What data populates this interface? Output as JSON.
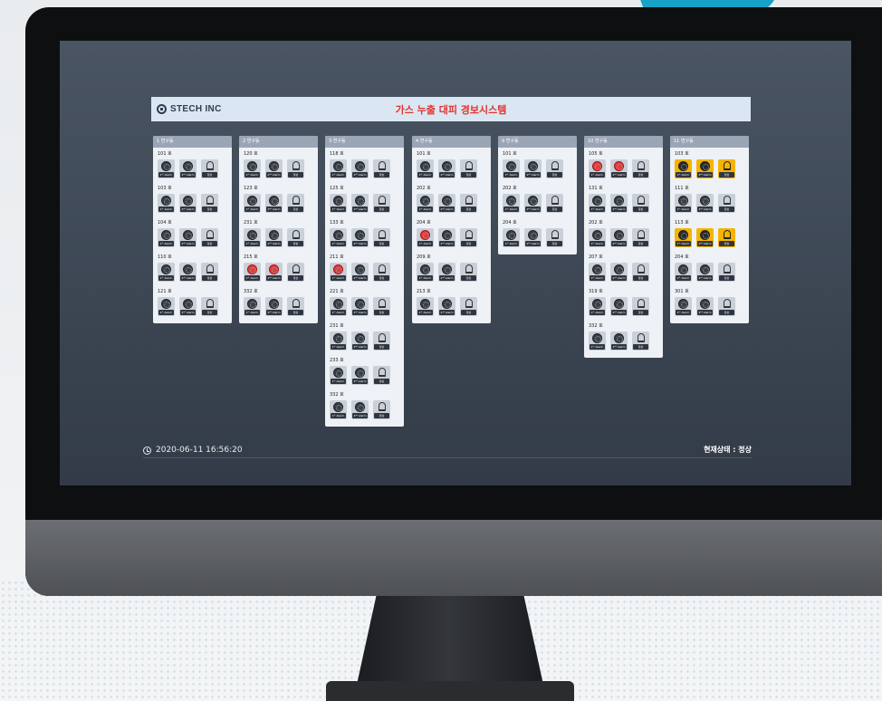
{
  "app": {
    "logo_text": "STECH INC",
    "title": "가스 누출 대피 경보시스템"
  },
  "buildings": [
    {
      "name": "1 연구동",
      "rooms": [
        {
          "label": "101 호",
          "state": [
            "normal",
            "normal",
            "normal"
          ]
        },
        {
          "label": "103 호",
          "state": [
            "normal",
            "normal",
            "normal"
          ]
        },
        {
          "label": "104 호",
          "state": [
            "normal",
            "normal",
            "normal"
          ]
        },
        {
          "label": "110 호",
          "state": [
            "normal",
            "normal",
            "normal"
          ]
        },
        {
          "label": "121 호",
          "state": [
            "normal",
            "normal",
            "normal"
          ]
        }
      ]
    },
    {
      "name": "2 연구동",
      "rooms": [
        {
          "label": "120 호",
          "state": [
            "normal",
            "normal",
            "normal"
          ]
        },
        {
          "label": "123 호",
          "state": [
            "normal",
            "normal",
            "normal"
          ]
        },
        {
          "label": "231 호",
          "state": [
            "normal",
            "normal",
            "normal"
          ]
        },
        {
          "label": "215 호",
          "state": [
            "red",
            "red",
            "normal"
          ]
        },
        {
          "label": "332 호",
          "state": [
            "normal",
            "normal",
            "normal"
          ]
        }
      ]
    },
    {
      "name": "3 연구동",
      "rooms": [
        {
          "label": "118 호",
          "state": [
            "normal",
            "normal",
            "normal"
          ]
        },
        {
          "label": "125 호",
          "state": [
            "normal",
            "normal",
            "normal"
          ]
        },
        {
          "label": "133 호",
          "state": [
            "normal",
            "normal",
            "normal"
          ]
        },
        {
          "label": "211 호",
          "state": [
            "red",
            "normal",
            "normal"
          ]
        },
        {
          "label": "221 호",
          "state": [
            "normal",
            "normal",
            "normal"
          ]
        },
        {
          "label": "231 호",
          "state": [
            "normal",
            "normal",
            "normal"
          ]
        },
        {
          "label": "233 호",
          "state": [
            "normal",
            "normal",
            "normal"
          ]
        },
        {
          "label": "332 호",
          "state": [
            "normal",
            "normal",
            "normal"
          ]
        }
      ]
    },
    {
      "name": "4 연구동",
      "rooms": [
        {
          "label": "101 호",
          "state": [
            "normal",
            "normal",
            "normal"
          ]
        },
        {
          "label": "202 호",
          "state": [
            "normal",
            "normal",
            "normal"
          ]
        },
        {
          "label": "204 호",
          "state": [
            "red",
            "normal",
            "normal"
          ]
        },
        {
          "label": "209 호",
          "state": [
            "normal",
            "normal",
            "normal"
          ]
        },
        {
          "label": "213 호",
          "state": [
            "normal",
            "normal",
            "normal"
          ]
        }
      ]
    },
    {
      "name": "9 연구동",
      "rooms": [
        {
          "label": "101 호",
          "state": [
            "normal",
            "normal",
            "normal"
          ]
        },
        {
          "label": "202 호",
          "state": [
            "normal",
            "normal",
            "normal"
          ]
        },
        {
          "label": "204 호",
          "state": [
            "normal",
            "normal",
            "normal"
          ]
        }
      ]
    },
    {
      "name": "10 연구동",
      "rooms": [
        {
          "label": "105 호",
          "state": [
            "red",
            "red",
            "normal"
          ]
        },
        {
          "label": "131 호",
          "state": [
            "normal",
            "normal",
            "normal"
          ]
        },
        {
          "label": "202 호",
          "state": [
            "normal",
            "normal",
            "normal"
          ]
        },
        {
          "label": "207 호",
          "state": [
            "normal",
            "normal",
            "normal"
          ]
        },
        {
          "label": "319 호",
          "state": [
            "normal",
            "normal",
            "normal"
          ]
        },
        {
          "label": "332 호",
          "state": [
            "normal",
            "normal",
            "normal"
          ]
        }
      ]
    },
    {
      "name": "11 연구동",
      "rooms": [
        {
          "label": "103 호",
          "state": [
            "yellow",
            "yellow",
            "yellow"
          ]
        },
        {
          "label": "111 호",
          "state": [
            "normal",
            "normal",
            "normal"
          ]
        },
        {
          "label": "113 호",
          "state": [
            "yellow",
            "yellow",
            "yellow"
          ]
        },
        {
          "label": "204 호",
          "state": [
            "normal",
            "normal",
            "normal"
          ]
        },
        {
          "label": "301 호",
          "state": [
            "normal",
            "normal",
            "normal"
          ]
        }
      ]
    }
  ],
  "tile_labels": {
    "alarm1": "1ˢᵗ Alarm",
    "alarm2": "2ⁿᵈ Alarm",
    "normal": "정상"
  },
  "status": {
    "timestamp": "2020-06-11 16:56:20",
    "current": "현재상태 : 정상"
  },
  "colors": {
    "alert_red": "#e23c3c",
    "warn_yellow": "#f4b400",
    "title_red": "#e0342c"
  }
}
